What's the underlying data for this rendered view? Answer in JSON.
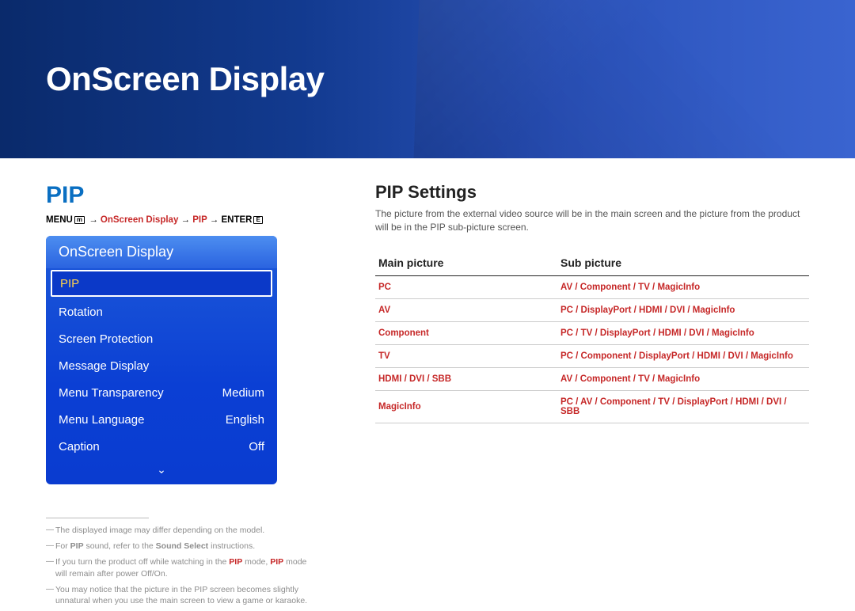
{
  "banner_title": "OnScreen Display",
  "section_title": "PIP",
  "breadcrumb": {
    "menu": "MENU",
    "arrow": "→",
    "p1": "OnScreen Display",
    "p2": "PIP",
    "enter": "ENTER"
  },
  "osd": {
    "title": "OnScreen Display",
    "items": [
      {
        "label": "PIP",
        "value": "",
        "selected": true
      },
      {
        "label": "Rotation",
        "value": ""
      },
      {
        "label": "Screen Protection",
        "value": ""
      },
      {
        "label": "Message Display",
        "value": ""
      },
      {
        "label": "Menu Transparency",
        "value": "Medium"
      },
      {
        "label": "Menu Language",
        "value": "English"
      },
      {
        "label": "Caption",
        "value": "Off"
      }
    ],
    "more_glyph": "⌄"
  },
  "notes": {
    "n1_a": "The displayed image may differ depending on the model.",
    "n2_a": "For ",
    "n2_b": "PIP",
    "n2_c": " sound, refer to the ",
    "n2_d": "Sound Select",
    "n2_e": " instructions.",
    "n3_a": "If you turn the product off while watching in the ",
    "n3_b": "PIP",
    "n3_c": " mode, ",
    "n3_d": "PIP",
    "n3_e": " mode will remain after power Off/On.",
    "n4_a": "You may notice that the picture in the PIP screen becomes slightly unnatural when you use the main screen to view a game or karaoke."
  },
  "right": {
    "heading": "PIP Settings",
    "desc": "The picture from the external video source will be in the main screen and the picture from the product will be in the PIP sub-picture screen.",
    "th_main": "Main picture",
    "th_sub": "Sub picture",
    "rows": [
      {
        "m": "PC",
        "s": "AV / Component / TV / MagicInfo"
      },
      {
        "m": "AV",
        "s": "PC / DisplayPort / HDMI / DVI / MagicInfo"
      },
      {
        "m": "Component",
        "s": "PC / TV / DisplayPort / HDMI / DVI / MagicInfo"
      },
      {
        "m": "TV",
        "s": "PC / Component / DisplayPort / HDMI / DVI / MagicInfo"
      },
      {
        "m": "HDMI / DVI / SBB",
        "s": "AV / Component / TV / MagicInfo"
      },
      {
        "m": "MagicInfo",
        "s": "PC / AV / Component / TV / DisplayPort / HDMI / DVI / SBB"
      }
    ]
  }
}
